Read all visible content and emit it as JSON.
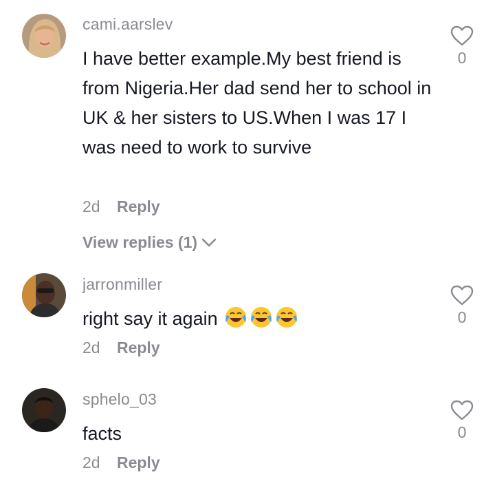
{
  "comments": [
    {
      "username": "cami.aarslev",
      "text": "I have better example.My best friend is from Nigeria.Her dad send her to school in UK & her sisters to US.When I was 17 I was need to work to survive",
      "time": "2d",
      "reply_label": "Reply",
      "view_replies_label": "View replies (1)",
      "likes": "0"
    },
    {
      "username": "jarronmiller",
      "text": "right say it again",
      "emoji": "face-with-tears-of-joy x3",
      "time": "2d",
      "reply_label": "Reply",
      "likes": "0"
    },
    {
      "username": "sphelo_03",
      "text": "facts",
      "time": "2d",
      "reply_label": "Reply",
      "likes": "0"
    }
  ],
  "colors": {
    "text": "#161823",
    "secondary": "#8a8b91",
    "background": "#ffffff"
  }
}
